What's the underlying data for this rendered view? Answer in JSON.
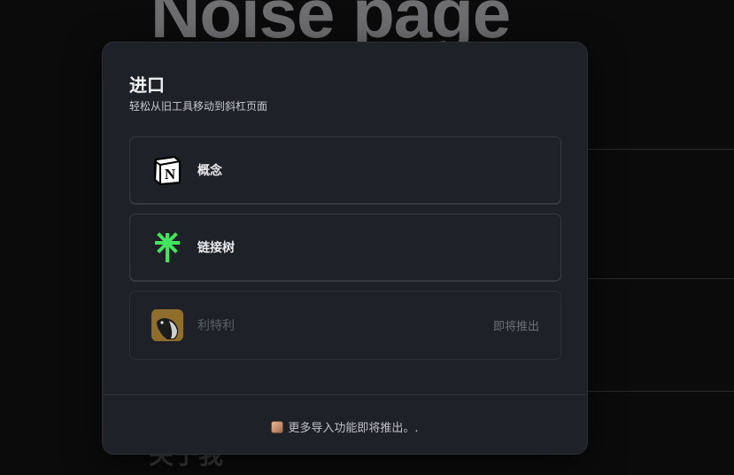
{
  "background": {
    "title": "Noise page",
    "bottom_text": "关于我"
  },
  "modal": {
    "title": "进口",
    "subtitle": "轻松从旧工具移动到斜杠页面",
    "options": [
      {
        "label": "概念",
        "icon": "notion-icon",
        "status": ""
      },
      {
        "label": "链接树",
        "icon": "linktree-icon",
        "status": ""
      },
      {
        "label": "利特利",
        "icon": "littlelink-icon",
        "status": "即将推出"
      }
    ],
    "footer_text": "更多导入功能即将推出。."
  },
  "colors": {
    "modal_bg": "#1f2128",
    "linktree_green": "#43e55e",
    "littlelink_gold": "#8f6d2b"
  }
}
